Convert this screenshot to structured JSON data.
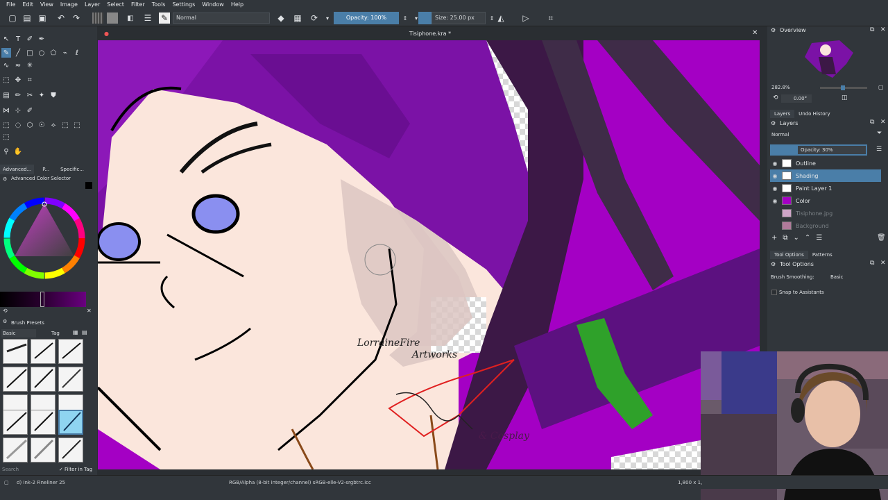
{
  "menu": [
    "File",
    "Edit",
    "View",
    "Image",
    "Layer",
    "Select",
    "Filter",
    "Tools",
    "Settings",
    "Window",
    "Help"
  ],
  "toolbar": {
    "blend_mode": "Normal",
    "opacity": "Opacity: 100%",
    "size": "Size: 25.00 px"
  },
  "document": {
    "title": "Tisiphone.kra *"
  },
  "left_panel": {
    "tabs": [
      "Advanced...",
      "P...",
      "Specific..."
    ],
    "color_selector_title": "Advanced Color Selector",
    "brush_presets_title": "Brush Presets",
    "brush_filter": "Basic",
    "tag_label": "Tag",
    "search_placeholder": "Search",
    "filter_in_tag": "Filter in Tag"
  },
  "canvas": {
    "watermark_line1": "LorraineFire",
    "watermark_line2": "Artworks",
    "watermark_line3": "& Cosplay"
  },
  "overview": {
    "title": "Overview",
    "zoom": "282.8%",
    "rotation": "0.00°"
  },
  "layers_panel": {
    "tabs": [
      "Layers",
      "Undo History"
    ],
    "title": "Layers",
    "blend": "Normal",
    "opacity": "Opacity: 30%",
    "layers": [
      {
        "name": "Outline",
        "visible": true
      },
      {
        "name": "Shading",
        "visible": true,
        "selected": true
      },
      {
        "name": "Paint Layer 1",
        "visible": true
      },
      {
        "name": "Color",
        "visible": true
      },
      {
        "name": "Tisiphone.jpg",
        "visible": false
      },
      {
        "name": "Background",
        "visible": false
      }
    ]
  },
  "tool_options": {
    "tabs": [
      "Tool Options",
      "Patterns"
    ],
    "title": "Tool Options",
    "smoothing_label": "Brush Smoothing:",
    "smoothing_value": "Basic",
    "snap_label": "Snap to Assistants"
  },
  "status": {
    "brush": "d) Ink-2 Fineliner 25",
    "color_profile": "RGB/Alpha (8-bit integer/channel)  sRGB-elle-V2-srgbtrc.icc",
    "dims": "1,800 x 1,"
  },
  "colors": {
    "accent": "#4a7ea8",
    "hair": "#7b12a6",
    "skin": "#fbe9df",
    "bg": "#a700c8"
  }
}
